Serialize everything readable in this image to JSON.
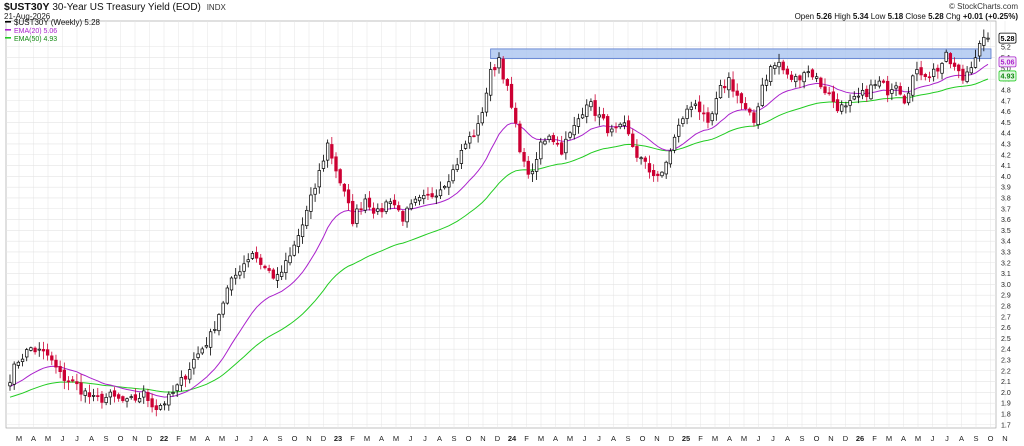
{
  "header": {
    "symbol": "$UST30Y",
    "name": "30-Year US Treasury Yield (EOD)",
    "exchange": "INDX",
    "date": "21-Aug-2026",
    "logo": "© StockCharts.com",
    "open_label": "Open",
    "open": "5.26",
    "high_label": "High",
    "high": "5.34",
    "low_label": "Low",
    "low": "5.18",
    "close_label": "Close",
    "close": "5.28",
    "chg_label": "Chg",
    "chg": "+0.01 (+0.25%)"
  },
  "legend": {
    "main": "$UST30Y (Weekly) 5.28",
    "ema20": "EMA(20) 5.06",
    "ema50": "EMA(50) 4.93"
  },
  "colors": {
    "up_candle": "#000000",
    "down_candle": "#cc0033",
    "ema20": "#aa22cc",
    "ema50": "#22cc22",
    "resistance_fill": "#aac4f0",
    "resistance_stroke": "#5577cc",
    "grid": "#e4e4e4"
  },
  "chart_data": {
    "type": "candlestick",
    "period": "weekly",
    "ylim": [
      1.67,
      5.42
    ],
    "y_ticks": [
      "1.7",
      "1.8",
      "1.9",
      "2.0",
      "2.1",
      "2.2",
      "2.3",
      "2.4",
      "2.5",
      "2.6",
      "2.7",
      "2.8",
      "2.9",
      "3.0",
      "3.1",
      "3.2",
      "3.3",
      "3.4",
      "3.5",
      "3.6",
      "3.7",
      "3.8",
      "3.9",
      "4.0",
      "4.1",
      "4.2",
      "4.3",
      "4.4",
      "4.5",
      "4.6",
      "4.7",
      "4.8",
      "4.9",
      "5.0",
      "5.1",
      "5.2"
    ],
    "x_labels": [
      "M",
      "A",
      "M",
      "J",
      "J",
      "A",
      "S",
      "O",
      "N",
      "D",
      "22",
      "F",
      "M",
      "A",
      "M",
      "J",
      "J",
      "A",
      "S",
      "O",
      "N",
      "D",
      "23",
      "F",
      "M",
      "A",
      "M",
      "J",
      "J",
      "A",
      "S",
      "O",
      "N",
      "D",
      "24",
      "F",
      "M",
      "A",
      "M",
      "J",
      "J",
      "A",
      "S",
      "O",
      "N",
      "D",
      "25",
      "F",
      "M",
      "A",
      "M",
      "J",
      "J",
      "A",
      "S",
      "O",
      "N",
      "D",
      "26",
      "F",
      "M",
      "A",
      "M",
      "J",
      "J",
      "A",
      "S",
      "O",
      "N"
    ],
    "resistance_zone": [
      5.09,
      5.18
    ],
    "price_tags": [
      {
        "label": "5.28",
        "value": 5.28,
        "kind": "close"
      },
      {
        "label": "5.06",
        "value": 5.06,
        "kind": "ema20"
      },
      {
        "label": "4.93",
        "value": 4.93,
        "kind": "ema50"
      }
    ],
    "anchors": [
      {
        "week": 0,
        "value": 2.14
      },
      {
        "week": 2,
        "value": 2.3
      },
      {
        "week": 5,
        "value": 2.41
      },
      {
        "week": 9,
        "value": 2.34
      },
      {
        "week": 12,
        "value": 2.16
      },
      {
        "week": 16,
        "value": 2.06
      },
      {
        "week": 20,
        "value": 1.93
      },
      {
        "week": 24,
        "value": 1.96
      },
      {
        "week": 28,
        "value": 1.9
      },
      {
        "week": 32,
        "value": 1.98
      },
      {
        "week": 35,
        "value": 1.86
      },
      {
        "week": 38,
        "value": 1.94
      },
      {
        "week": 41,
        "value": 2.1
      },
      {
        "week": 44,
        "value": 2.3
      },
      {
        "week": 48,
        "value": 2.52
      },
      {
        "week": 52,
        "value": 2.95
      },
      {
        "week": 55,
        "value": 3.15
      },
      {
        "week": 58,
        "value": 3.3
      },
      {
        "week": 61,
        "value": 3.15
      },
      {
        "week": 64,
        "value": 3.05
      },
      {
        "week": 67,
        "value": 3.25
      },
      {
        "week": 70,
        "value": 3.55
      },
      {
        "week": 73,
        "value": 3.9
      },
      {
        "week": 76,
        "value": 4.3
      },
      {
        "week": 79,
        "value": 3.95
      },
      {
        "week": 82,
        "value": 3.6
      },
      {
        "week": 85,
        "value": 3.8
      },
      {
        "week": 88,
        "value": 3.65
      },
      {
        "week": 91,
        "value": 3.8
      },
      {
        "week": 94,
        "value": 3.62
      },
      {
        "week": 97,
        "value": 3.75
      },
      {
        "week": 100,
        "value": 3.8
      },
      {
        "week": 103,
        "value": 3.9
      },
      {
        "week": 106,
        "value": 4.05
      },
      {
        "week": 109,
        "value": 4.3
      },
      {
        "week": 112,
        "value": 4.45
      },
      {
        "week": 115,
        "value": 4.95
      },
      {
        "week": 117,
        "value": 5.1
      },
      {
        "week": 119,
        "value": 4.8
      },
      {
        "week": 121,
        "value": 4.45
      },
      {
        "week": 123,
        "value": 4.1
      },
      {
        "week": 125,
        "value": 4.0
      },
      {
        "week": 127,
        "value": 4.3
      },
      {
        "week": 129,
        "value": 4.4
      },
      {
        "week": 132,
        "value": 4.25
      },
      {
        "week": 135,
        "value": 4.45
      },
      {
        "week": 138,
        "value": 4.7
      },
      {
        "week": 141,
        "value": 4.55
      },
      {
        "week": 144,
        "value": 4.4
      },
      {
        "week": 147,
        "value": 4.45
      },
      {
        "week": 150,
        "value": 4.2
      },
      {
        "week": 153,
        "value": 4.05
      },
      {
        "week": 156,
        "value": 4.0
      },
      {
        "week": 158,
        "value": 4.25
      },
      {
        "week": 161,
        "value": 4.55
      },
      {
        "week": 164,
        "value": 4.7
      },
      {
        "week": 167,
        "value": 4.45
      },
      {
        "week": 170,
        "value": 4.8
      },
      {
        "week": 172,
        "value": 4.9
      },
      {
        "week": 174,
        "value": 4.75
      },
      {
        "week": 176,
        "value": 4.6
      },
      {
        "week": 178,
        "value": 4.5
      },
      {
        "week": 180,
        "value": 4.85
      },
      {
        "week": 182,
        "value": 5.0
      },
      {
        "week": 184,
        "value": 5.05
      },
      {
        "week": 186,
        "value": 4.92
      },
      {
        "week": 188,
        "value": 4.9
      },
      {
        "week": 190,
        "value": 4.98
      },
      {
        "week": 192,
        "value": 4.95
      },
      {
        "week": 194,
        "value": 4.85
      },
      {
        "week": 196,
        "value": 4.75
      },
      {
        "week": 198,
        "value": 4.65
      },
      {
        "week": 200,
        "value": 4.62
      },
      {
        "week": 202,
        "value": 4.7
      },
      {
        "week": 204,
        "value": 4.75
      },
      {
        "week": 206,
        "value": 4.82
      },
      {
        "week": 208,
        "value": 4.86
      },
      {
        "week": 210,
        "value": 4.8
      },
      {
        "week": 212,
        "value": 4.88
      },
      {
        "week": 214,
        "value": 4.72
      },
      {
        "week": 216,
        "value": 4.92
      },
      {
        "week": 218,
        "value": 4.97
      },
      {
        "week": 220,
        "value": 4.95
      },
      {
        "week": 222,
        "value": 5.0
      },
      {
        "week": 224,
        "value": 5.1
      },
      {
        "week": 226,
        "value": 5.0
      },
      {
        "week": 228,
        "value": 4.9
      },
      {
        "week": 230,
        "value": 5.05
      },
      {
        "week": 232,
        "value": 5.2
      },
      {
        "week": 234,
        "value": 5.28
      }
    ]
  }
}
